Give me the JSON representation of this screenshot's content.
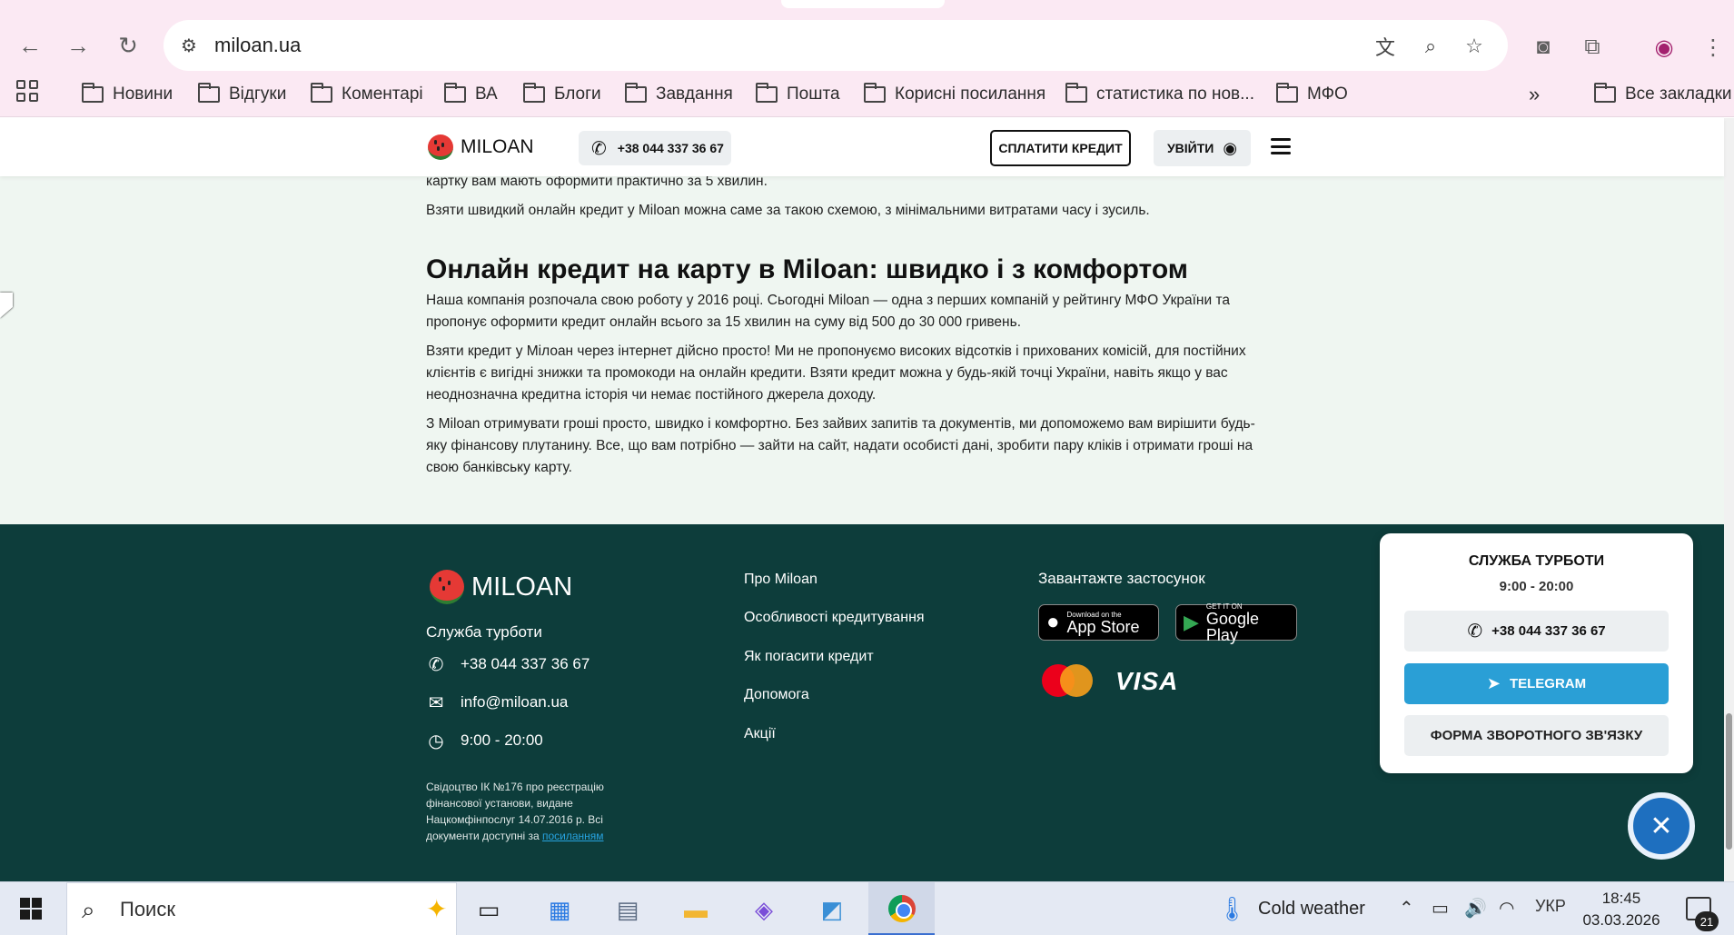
{
  "browser": {
    "url": "miloan.ua",
    "bookmarks": [
      "Новини",
      "Відгуки",
      "Коментарі",
      "ВА",
      "Блоги",
      "Завдання",
      "Пошта",
      "Корисні посилання",
      "статистика по нов...",
      "МФО"
    ],
    "all_bookmarks": "Все закладки",
    "more": "»"
  },
  "header": {
    "logo_text": "MILOAN",
    "phone": "+38 044 337 36 67",
    "pay_label": "СПЛАТИТИ КРЕДИТ",
    "login_label": "УВІЙТИ"
  },
  "content": {
    "p0": "картку вам мають оформити практично за 5 хвилин.",
    "p1": "Взяти швидкий онлайн кредит у Miloan можна саме за такою схемою, з мінімальними витратами часу і зусиль.",
    "heading": "Онлайн кредит на карту в Miloan: швидко і з комфортом",
    "p2_l1": "Наша компанія розпочала свою роботу у 2016 році. Сьогодні Miloan — одна з перших компаній у рейтингу МФО України та",
    "p2_l2": "пропонує оформити кредит онлайн всього за 15 хвилин на суму від 500 до 30 000 гривень.",
    "p3_l1": "Взяти кредит у Мілоан через інтернет дійсно просто! Ми не пропонуємо високих відсотків і прихованих комісій, для постійних",
    "p3_l2": "клієнтів є вигідні знижки та промокоди на онлайн кредити. Взяти кредит можна у будь-якій точці України, навіть якщо у вас",
    "p3_l3": "неоднозначна кредитна історія чи немає постійного джерела доходу.",
    "p4_l1": "З Miloan отримувати гроші просто, швидко і комфортно. Без зайвих запитів та документів, ми допоможемо вам вирішити будь-",
    "p4_l2": "яку фінансову плутанину. Все, що вам потрібно — зайти на сайт, надати особисті дані, зробити пару кліків і отримати гроші на",
    "p4_l3": "свою банківську карту."
  },
  "footer": {
    "logo_text": "MILOAN",
    "care_title": "Служба турботи",
    "phone": "+38 044 337 36 67",
    "email": "info@miloan.ua",
    "hours": "9:00 - 20:00",
    "legal": "Свідоцтво ІК №176 про реєстрацію фінансової установи, видане Нацкомфінпослуг 14.07.2016 р. Всі документи доступні за",
    "legal_link": "посиланням",
    "links": [
      "Про Miloan",
      "Особливості кредитування",
      "Як погасити кредит",
      "Допомога",
      "Акції"
    ],
    "app_title": "Завантажте застосунок",
    "appstore_small": "Download on the",
    "appstore_big": "App Store",
    "gplay_small": "GET IT ON",
    "gplay_big": "Google Play",
    "visa": "VISA"
  },
  "care_card": {
    "title": "СЛУЖБА ТУРБОТИ",
    "hours": "9:00 - 20:00",
    "phone": "+38 044 337 36 67",
    "telegram": "TELEGRAM",
    "feedback": "ФОРМА ЗВОРОТНОГО ЗВ'ЯЗКУ"
  },
  "taskbar": {
    "search_placeholder": "Поиск",
    "weather": "Cold weather",
    "lang": "УКР",
    "time": "18:45",
    "date": "03.03.2026",
    "notifications": "21"
  },
  "colors": {
    "chrome_bg": "#fbe9f3",
    "content_bg": "#eff6f1",
    "footer_bg": "#0d3d3b",
    "telegram": "#2a9fd6",
    "melon_red": "#e53935"
  }
}
